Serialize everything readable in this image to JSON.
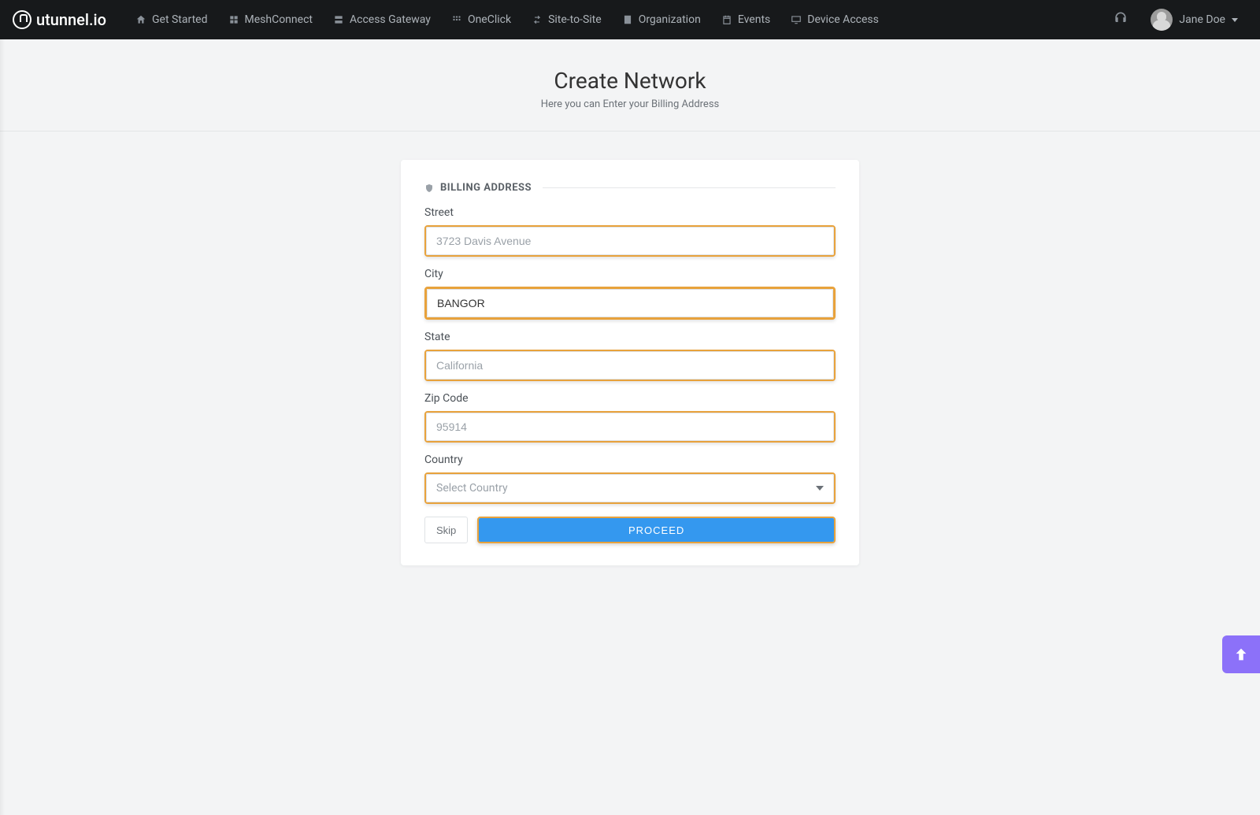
{
  "brand": "utunnel.io",
  "nav": {
    "items": [
      {
        "label": "Get Started",
        "icon": "home-icon"
      },
      {
        "label": "MeshConnect",
        "icon": "mesh-icon"
      },
      {
        "label": "Access Gateway",
        "icon": "server-icon"
      },
      {
        "label": "OneClick",
        "icon": "apps-icon"
      },
      {
        "label": "Site-to-Site",
        "icon": "sitetosite-icon"
      },
      {
        "label": "Organization",
        "icon": "building-icon"
      },
      {
        "label": "Events",
        "icon": "calendar-icon"
      },
      {
        "label": "Device Access",
        "icon": "monitor-icon"
      }
    ]
  },
  "user": {
    "name": "Jane Doe"
  },
  "header": {
    "title": "Create Network",
    "subtitle": "Here you can Enter your Billing Address"
  },
  "section": {
    "title": "BILLING ADDRESS"
  },
  "form": {
    "street_label": "Street",
    "street_value": "",
    "street_placeholder": "3723 Davis Avenue",
    "city_label": "City",
    "city_value": "BANGOR",
    "state_label": "State",
    "state_value": "",
    "state_placeholder": "California",
    "zip_label": "Zip Code",
    "zip_value": "",
    "zip_placeholder": "95914",
    "country_label": "Country",
    "country_value": "Select Country"
  },
  "buttons": {
    "skip": "Skip",
    "proceed": "PROCEED"
  }
}
